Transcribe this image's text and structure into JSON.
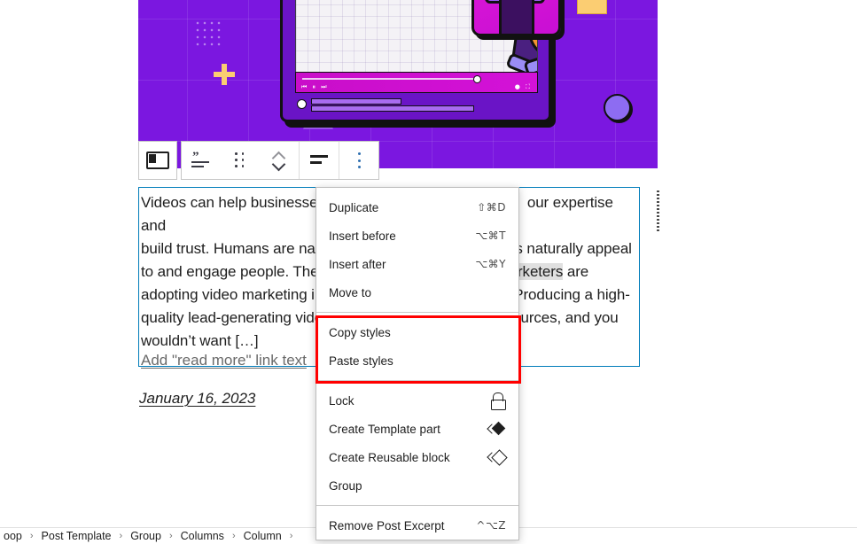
{
  "editor": {
    "hero_image": {
      "alt": "purple-video-marketing-illustration",
      "bg_color": "#7b17e0",
      "accent_magenta": "#cc0fd2",
      "accent_orange": "#f59331",
      "accent_yellow": "#fbcd72",
      "accent_lavender": "#9a8cf5"
    },
    "toolbar": {
      "sidebar_toggle_label": "Toggle block inserter / sidebar",
      "block_type_label": "Post Excerpt",
      "drag_label": "Drag",
      "move_up_label": "Move up",
      "move_down_label": "Move down",
      "align_label": "Align text",
      "options_label": "Options"
    },
    "excerpt_block": {
      "paragraph_line_1": "Videos can help businesses",
      "paragraph_line_2": "build trust. Humans are nat",
      "paragraph_line_3": "to and engage people. Ther",
      "paragraph_line_4": "adopting video marketing in",
      "paragraph_line_5": "quality lead-generating vide",
      "paragraph_line_6": "wouldn’t want […]",
      "right_line_1": "our expertise and",
      "right_line_2": "s naturally appeal",
      "right_line_3_highlight": "rketers",
      "right_line_3_rest": " are",
      "right_line_4": "Producing a high-",
      "right_line_5": "ources, and you",
      "read_more_label": "Add \"read more\" link text"
    },
    "date_block": {
      "date": "January 16, 2023"
    },
    "context_menu": {
      "groups": [
        {
          "items": [
            {
              "label": "Duplicate",
              "shortcut": "⇧⌘D",
              "icon": ""
            },
            {
              "label": "Insert before",
              "shortcut": "⌥⌘T",
              "icon": ""
            },
            {
              "label": "Insert after",
              "shortcut": "⌥⌘Y",
              "icon": ""
            },
            {
              "label": "Move to",
              "shortcut": "",
              "icon": ""
            }
          ]
        },
        {
          "highlighted": true,
          "items": [
            {
              "label": "Copy styles",
              "shortcut": "",
              "icon": ""
            },
            {
              "label": "Paste styles",
              "shortcut": "",
              "icon": ""
            }
          ]
        },
        {
          "items": [
            {
              "label": "Lock",
              "shortcut": "",
              "icon": "lock-icon"
            },
            {
              "label": "Create Template part",
              "shortcut": "",
              "icon": "template-part-icon"
            },
            {
              "label": "Create Reusable block",
              "shortcut": "",
              "icon": "reusable-block-icon"
            },
            {
              "label": "Group",
              "shortcut": "",
              "icon": ""
            }
          ]
        },
        {
          "items": [
            {
              "label": "Remove Post Excerpt",
              "shortcut": "^⌥Z",
              "icon": ""
            }
          ]
        }
      ],
      "highlight_color": "#ff0000"
    },
    "breadcrumb": {
      "items": [
        "oop",
        "Post Template",
        "Group",
        "Columns",
        "Column"
      ],
      "separator": "›"
    },
    "colors": {
      "block_selected_border": "#007cba",
      "menu_border": "#bdbdbd",
      "text": "#1e1e1e"
    }
  }
}
